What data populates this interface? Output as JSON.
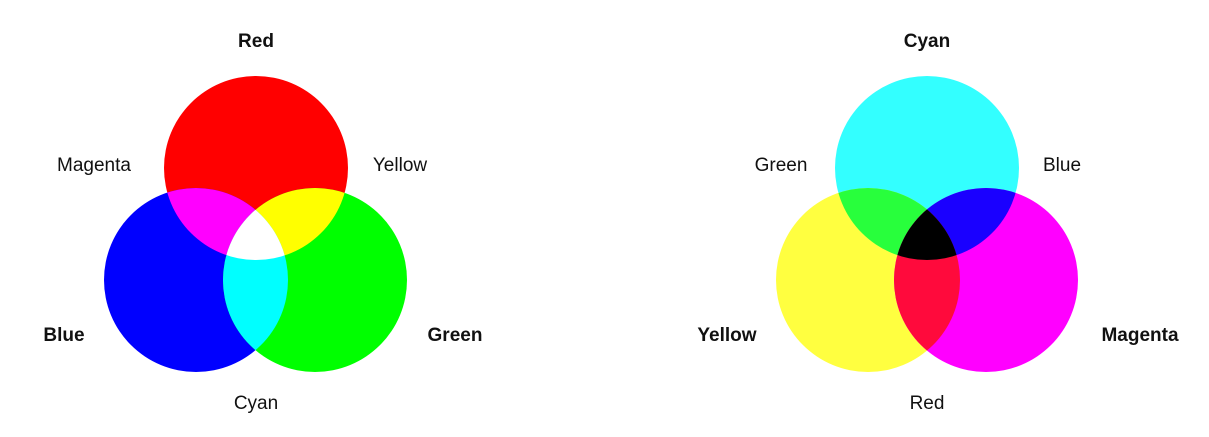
{
  "diagrams": [
    {
      "mode": "additive",
      "primaries": {
        "top": {
          "label": "Red",
          "color": "#ff0000"
        },
        "left": {
          "label": "Blue",
          "color": "#0000ff"
        },
        "right": {
          "label": "Green",
          "color": "#00ff00"
        }
      },
      "overlaps": {
        "top_left": {
          "label": "Magenta",
          "color": "#ff00ff"
        },
        "top_right": {
          "label": "Yellow",
          "color": "#ffff00"
        },
        "bottom": {
          "label": "Cyan",
          "color": "#00ffff"
        },
        "center": {
          "color": "#ffffff"
        }
      }
    },
    {
      "mode": "subtractive",
      "primaries": {
        "top": {
          "label": "Cyan",
          "color": "#33ffff"
        },
        "left": {
          "label": "Yellow",
          "color": "#ffff40"
        },
        "right": {
          "label": "Magenta",
          "color": "#ff00ff"
        }
      },
      "overlaps": {
        "top_left": {
          "label": "Green",
          "color": "#28ff3c"
        },
        "top_right": {
          "label": "Blue",
          "color": "#1a00ff"
        },
        "bottom": {
          "label": "Red",
          "color": "#ff0a3c"
        },
        "center": {
          "color": "#000000"
        }
      }
    }
  ]
}
